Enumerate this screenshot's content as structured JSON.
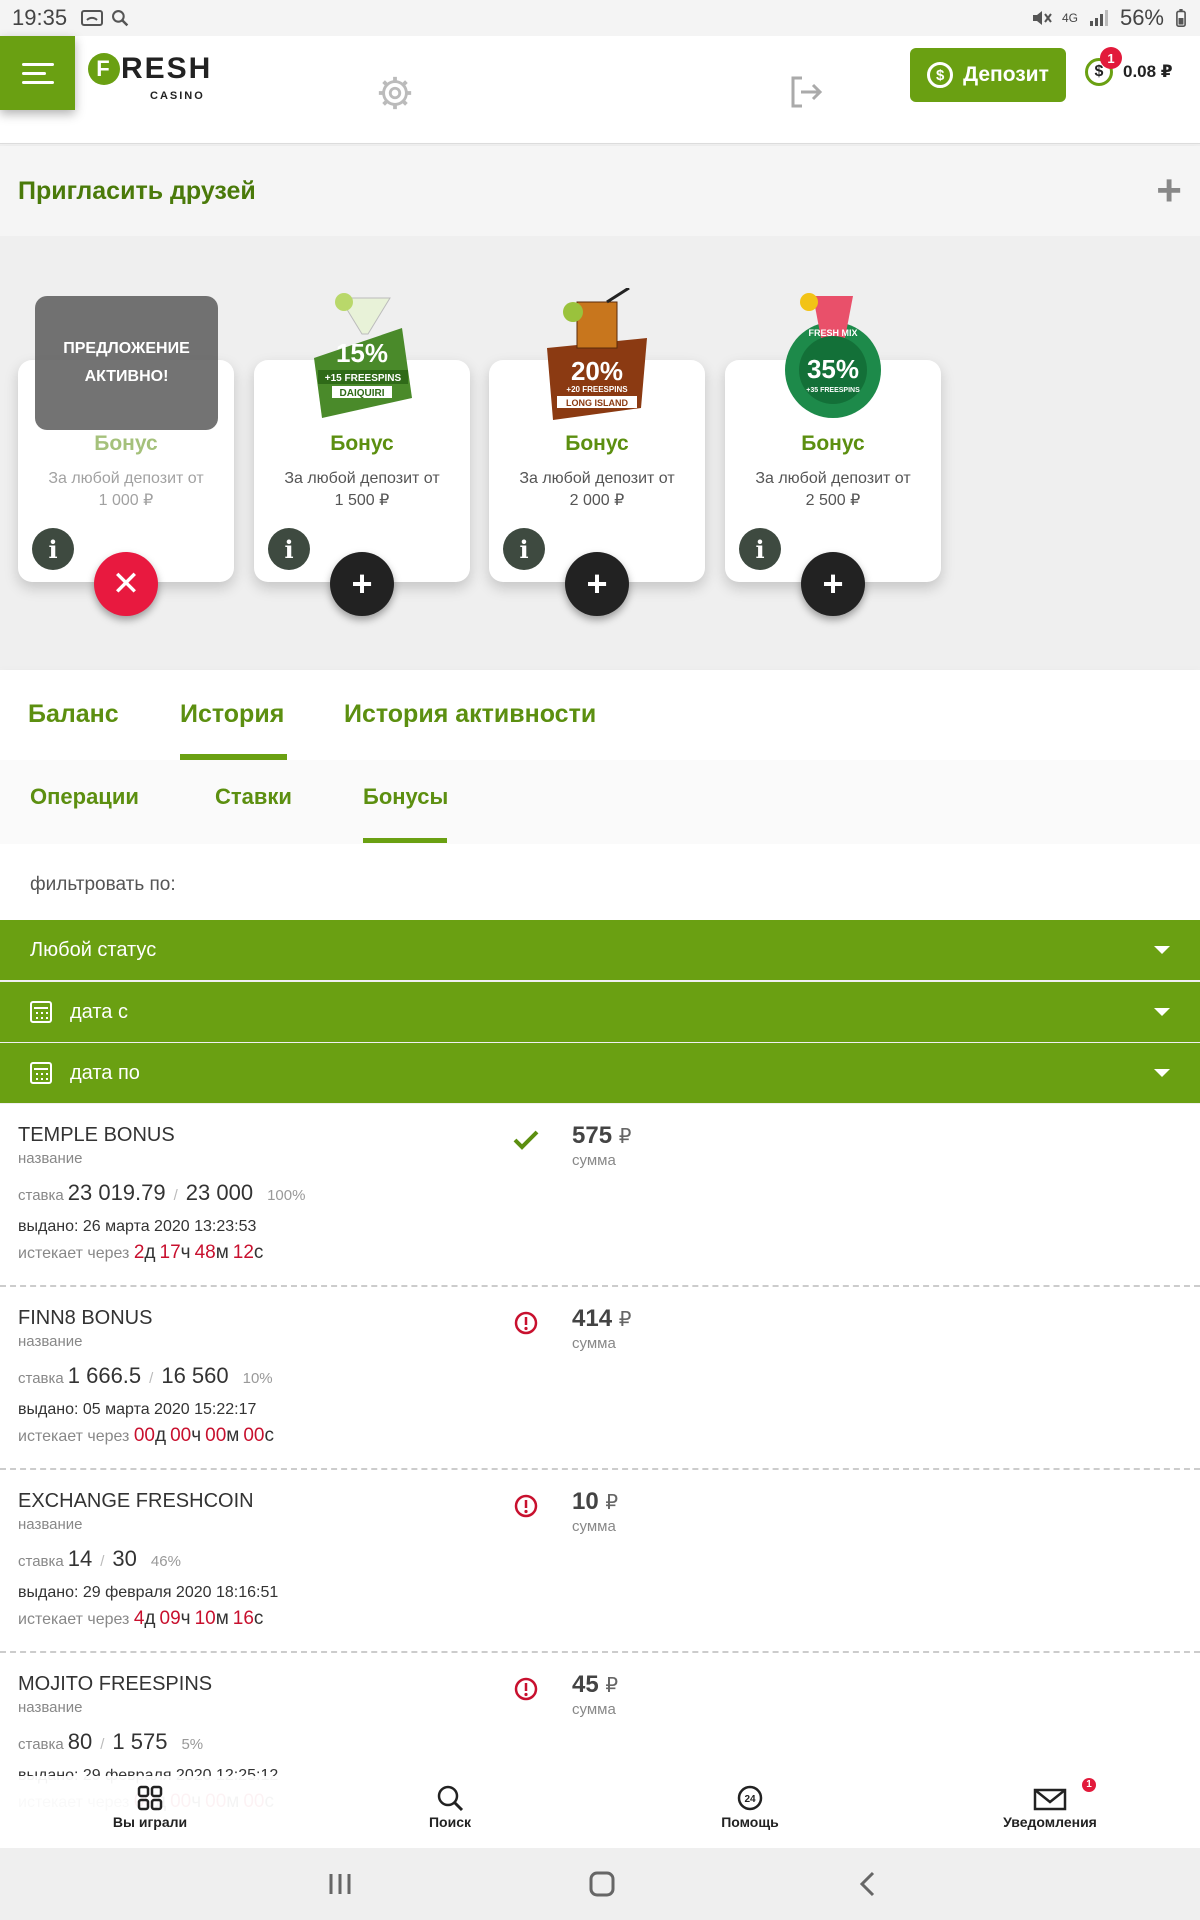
{
  "status_bar": {
    "time": "19:35",
    "network": "4G",
    "battery": "56%"
  },
  "header": {
    "logo_word": "RESH",
    "logo_letter": "F",
    "logo_sub": "CASINO",
    "deposit_label": "Депозит",
    "balance": "0.08 ₽",
    "wallet_badge": "1",
    "wallet_symbol": "$",
    "icons": [
      "menu-icon",
      "gear-icon",
      "logout-icon"
    ]
  },
  "invite": {
    "label": "Пригласить друзей",
    "plus": "+"
  },
  "bonus_cards": [
    {
      "title": "Бонус",
      "desc_line1": "За любой депозит от",
      "desc_line2": "1 000 ₽",
      "info": "i",
      "action": "✕",
      "overlay_line1": "ПРЕДЛОЖЕНИЕ",
      "overlay_line2": "АКТИВНО!"
    },
    {
      "title": "Бонус",
      "desc_line1": "За любой депозит от",
      "desc_line2": "1 500 ₽",
      "info": "i",
      "action": "+",
      "art_pct": "15%",
      "art_caption": "+15 FREESPINS",
      "art_name": "DAIQUIRI",
      "art_color": "#4a8a2a"
    },
    {
      "title": "Бонус",
      "desc_line1": "За любой депозит от",
      "desc_line2": "2 000 ₽",
      "info": "i",
      "action": "+",
      "art_pct": "20%",
      "art_caption": "+20 FREESPINS",
      "art_name": "LONG ISLAND",
      "art_color": "#8b3a12"
    },
    {
      "title": "Бонус",
      "desc_line1": "За любой депозит от",
      "desc_line2": "2 500 ₽",
      "info": "i",
      "action": "+",
      "art_pct": "35%",
      "art_caption": "+35 FREESPINS",
      "art_name": "FRESH MIX",
      "art_color": "#1d8a4a"
    }
  ],
  "tabs": {
    "balance": "Баланс",
    "history": "История",
    "activity": "История активности"
  },
  "subtabs": {
    "operations": "Операции",
    "bets": "Ставки",
    "bonuses": "Бонусы"
  },
  "filter": {
    "label": "фильтровать по:",
    "status": "Любой статус",
    "date_from": "дата с",
    "date_to": "дата по"
  },
  "labels": {
    "name": "название",
    "stake": "ставка",
    "amount": "сумма",
    "issued": "выдано:",
    "expires": "истекает через",
    "currency": "₽",
    "d": "д",
    "h": "ч",
    "m": "м",
    "s": "с"
  },
  "history": [
    {
      "name": "TEMPLE BONUS",
      "status": "done",
      "amount": "575",
      "stake_current": "23 019.79",
      "stake_total": "23 000",
      "stake_pct": "100%",
      "issued": "26 марта 2020 13:23:53",
      "exp_d": "2",
      "exp_h": "17",
      "exp_m": "48",
      "exp_s": "12"
    },
    {
      "name": "FINN8 BONUS",
      "status": "warning",
      "amount": "414",
      "stake_current": "1 666.5",
      "stake_total": "16 560",
      "stake_pct": "10%",
      "issued": "05 марта 2020 15:22:17",
      "exp_d": "00",
      "exp_h": "00",
      "exp_m": "00",
      "exp_s": "00"
    },
    {
      "name": "EXCHANGE FRESHCOIN",
      "status": "warning",
      "amount": "10",
      "stake_current": "14",
      "stake_total": "30",
      "stake_pct": "46%",
      "issued": "29 февраля 2020 18:16:51",
      "exp_d": "4",
      "exp_h": "09",
      "exp_m": "10",
      "exp_s": "16"
    },
    {
      "name": "MOJITO FREESPINS",
      "status": "warning",
      "amount": "45",
      "stake_current": "80",
      "stake_total": "1 575",
      "stake_pct": "5%",
      "issued": "29 февраля 2020 12:25:12",
      "exp_d": "00",
      "exp_h": "00",
      "exp_m": "00",
      "exp_s": "00"
    }
  ],
  "bottom_nav": {
    "played": "Вы играли",
    "search": "Поиск",
    "help": "Помощь",
    "notifications": "Уведомления",
    "notif_badge": "1",
    "help_badge": "24"
  }
}
